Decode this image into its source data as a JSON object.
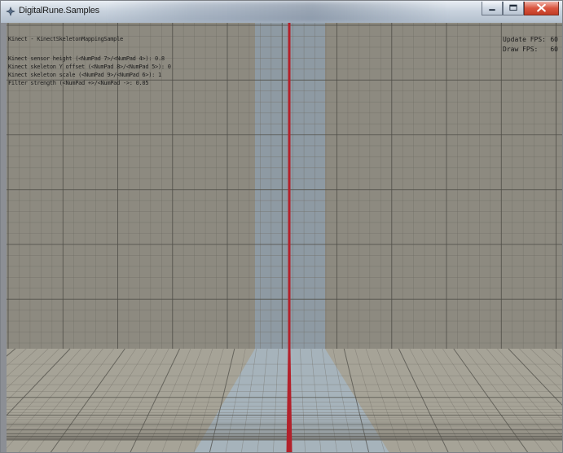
{
  "window": {
    "title": "DigitalRune.Samples",
    "icon": "app-logo-icon"
  },
  "caption_buttons": {
    "minimize": "minimize-icon",
    "maximize": "maximize-icon",
    "close": "close-icon"
  },
  "overlay": {
    "sample_title": "Kinect - KinectSkeletonMappingSample",
    "lines": [
      "Kinect sensor height (<NumPad 7>/<NumPad 4>): 0.8",
      "Kinect skeleton Y offset (<NumPad 8>/<NumPad 5>): 0",
      "Kinect skeleton scale (<NumPad 9>/<NumPad 6>): 1",
      "Filter strength (<NumPad +>/<NumPad ->: 0.05"
    ]
  },
  "stats": {
    "update_label": "Update FPS:",
    "update_value": "60",
    "draw_label": "Draw FPS:",
    "draw_value": "60"
  },
  "colors": {
    "wall": "#8d8a80",
    "wall_band": "#8e9aa3",
    "floor": "#a6a397",
    "floor_band": "#a6b3bb",
    "axis_line": "#b3212b",
    "grid_minor": "#6f6c63",
    "grid_major": "#4c4a44"
  }
}
